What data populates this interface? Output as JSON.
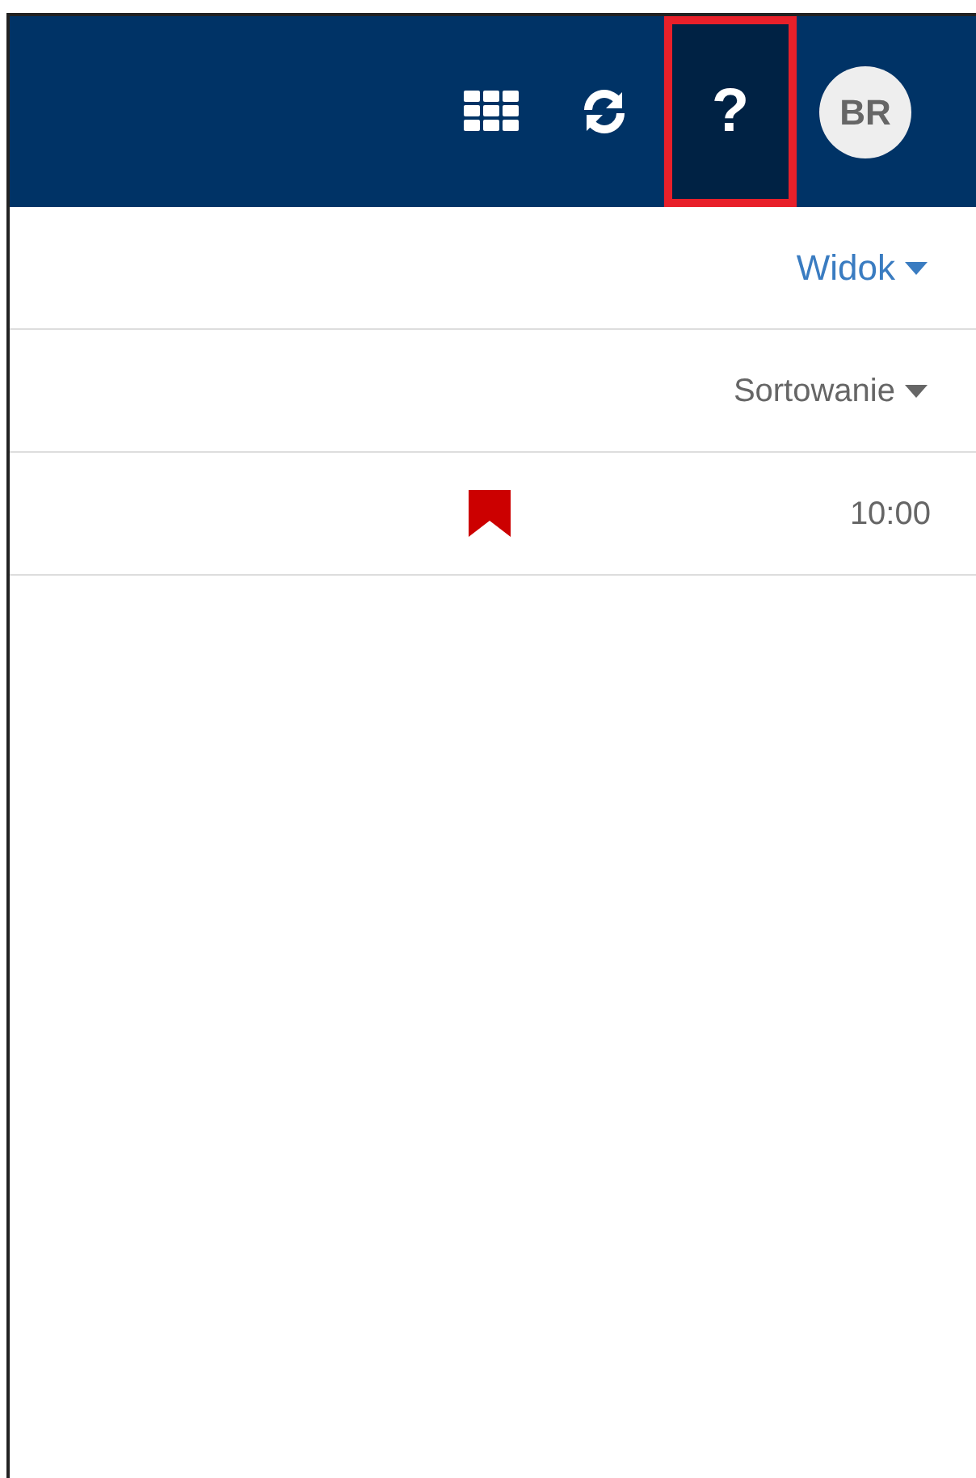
{
  "header": {
    "buttons": [
      {
        "kind": "apps"
      },
      {
        "kind": "refresh"
      },
      {
        "kind": "help",
        "label": "?",
        "highlighted": true
      }
    ],
    "avatar": {
      "initials": "BR"
    }
  },
  "view_menu": {
    "label": "Widok"
  },
  "sort_menu": {
    "label": "Sortowanie"
  },
  "messages": [
    {
      "flagged": true,
      "time": "10:00"
    }
  ]
}
